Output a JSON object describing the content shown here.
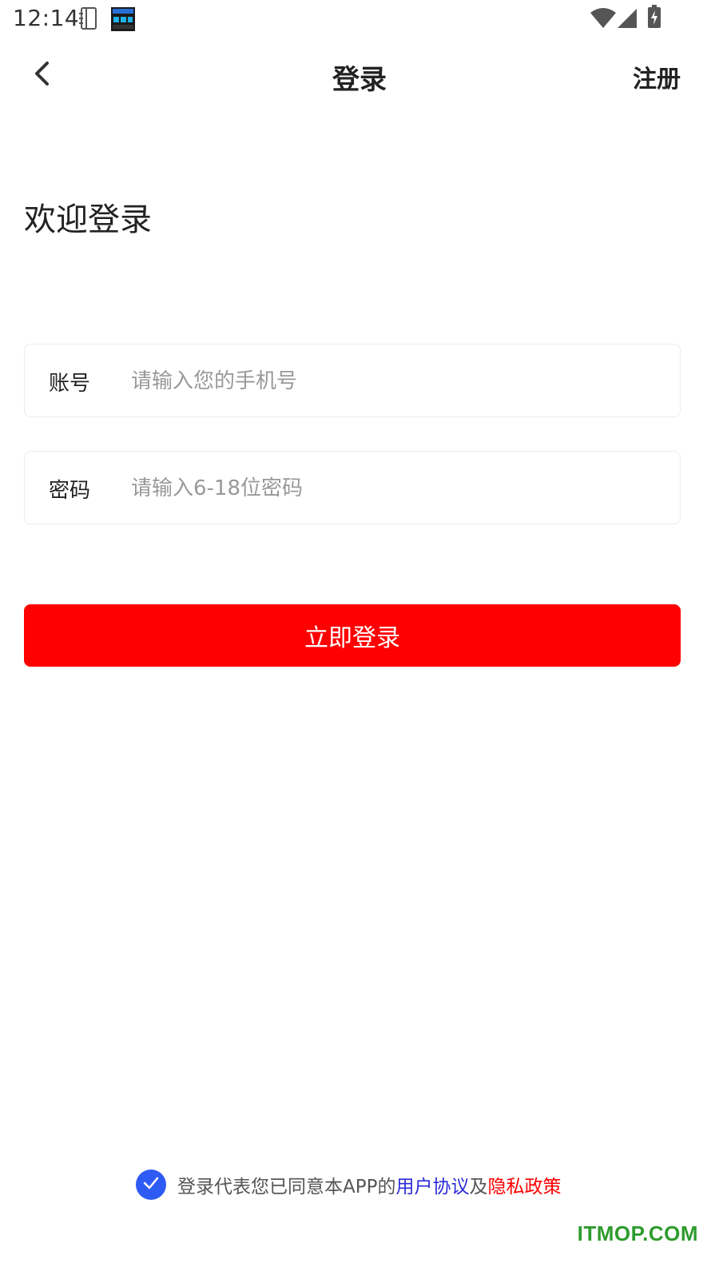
{
  "status_bar": {
    "time": "12:14",
    "icons": [
      "notebook-icon",
      "clock-widget-icon",
      "wifi-icon",
      "signal-icon",
      "battery-charging-icon"
    ]
  },
  "nav": {
    "title": "登录",
    "register_label": "注册",
    "back_icon": "chevron-left-icon"
  },
  "welcome_text": "欢迎登录",
  "form": {
    "account": {
      "label": "账号",
      "placeholder": "请输入您的手机号",
      "value": ""
    },
    "password": {
      "label": "密码",
      "placeholder": "请输入6-18位密码",
      "value": ""
    }
  },
  "login_button": {
    "label": "立即登录",
    "color": "#ff0000"
  },
  "agreement": {
    "checked": true,
    "check_color": "#2f5bf5",
    "prefix": "登录代表您已同意本APP的",
    "user_agreement": "用户协议",
    "conjunction": "及",
    "privacy_policy": "隐私政策"
  },
  "watermark": "ITMOP.COM"
}
